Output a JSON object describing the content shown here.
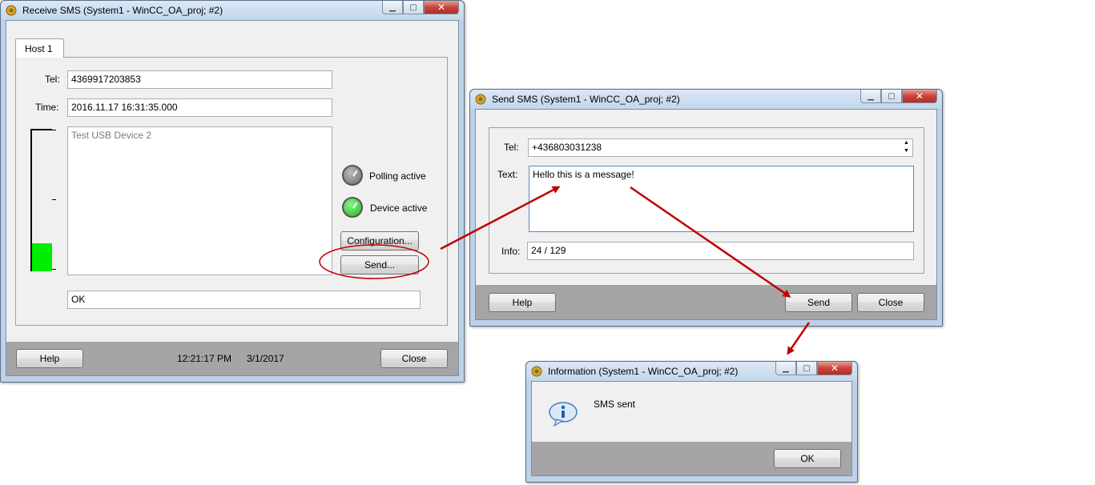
{
  "receive_window": {
    "title": "Receive SMS (System1 - WinCC_OA_proj; #2)",
    "tab_label": "Host 1",
    "tel_label": "Tel:",
    "tel_value": "4369917203853",
    "time_label": "Time:",
    "time_value": "2016.11.17 16:31:35.000",
    "message_text": "Test USB Device 2",
    "signal_level": 0.2,
    "polling_label": "Polling active",
    "device_label": "Device active",
    "configuration_label": "Configuration...",
    "send_label": "Send...",
    "status_value": "OK",
    "help_label": "Help",
    "clock_time": "12:21:17 PM",
    "clock_date": "3/1/2017",
    "close_label": "Close"
  },
  "send_window": {
    "title": "Send SMS (System1 - WinCC_OA_proj; #2)",
    "tel_label": "Tel:",
    "tel_value": "+436803031238",
    "text_label": "Text:",
    "text_value": "Hello this is a message!",
    "info_label": "Info:",
    "info_value": "24 / 129",
    "help_label": "Help",
    "send_label": "Send",
    "close_label": "Close"
  },
  "info_window": {
    "title": "Information (System1 - WinCC_OA_proj; #2)",
    "message": "SMS sent",
    "ok_label": "OK"
  },
  "colors": {
    "polling_led": "#7a7a7a",
    "device_led": "#22c322",
    "signal_bar": "#00ee00",
    "annotation": "#c00000"
  },
  "icons": {
    "app": "app-gear-icon",
    "info": "info-speech-icon"
  }
}
